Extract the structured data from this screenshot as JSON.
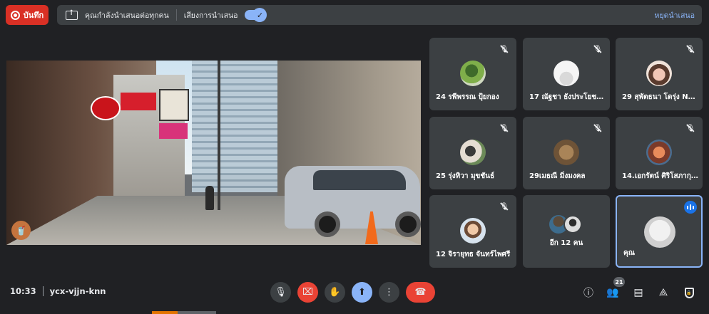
{
  "recording": {
    "label": "บันทึก"
  },
  "presentation": {
    "status_text": "คุณกำลังนำเสนอต่อทุกคน",
    "audio_label": "เสียงการนำเสนอ",
    "audio_enabled": true,
    "stop_label": "หยุดนำเสนอ"
  },
  "participants": [
    {
      "name": "24 รพีพรรณ ปุ้ยกอง",
      "muted": true
    },
    {
      "name": "17 ณัฐชา ธังประโยชน์ ...",
      "muted": true
    },
    {
      "name": "29 สุพัตธนา โดรุ่ง Nuey",
      "muted": true
    },
    {
      "name": "25 รุ่งทิวา มุขชันธ์",
      "muted": true
    },
    {
      "name": "29เมธณี มิ่งมงคล",
      "muted": true
    },
    {
      "name": "14.เอกรัตน์ ศิริโสภากุล...",
      "muted": true
    },
    {
      "name": "12 จิรายุทธ จันทร์ไพศรี",
      "muted": true
    }
  ],
  "more_participants": {
    "label": "อีก 12 คน"
  },
  "self_tile": {
    "label": "คุณ",
    "speaking": true
  },
  "meeting": {
    "time": "10:33",
    "code": "ycx-vjjn-knn"
  },
  "people_count": "21",
  "colors": {
    "record_red": "#d93025",
    "accent_blue": "#8ab4f8",
    "end_call_red": "#ea4335",
    "self_border": "#8ab4f8"
  }
}
